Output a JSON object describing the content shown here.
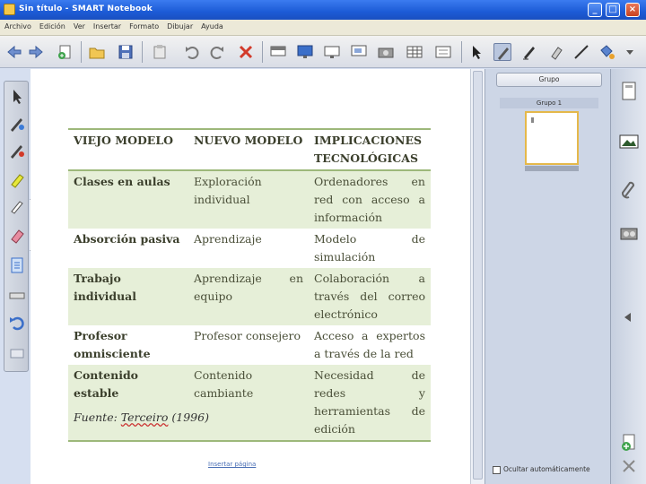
{
  "window": {
    "title": "Sin título - SMART Notebook",
    "buttons": {
      "minimize": "_",
      "maximize": "□",
      "close": "×"
    }
  },
  "menu": [
    "Archivo",
    "Edición",
    "Ver",
    "Insertar",
    "Formato",
    "Dibujar",
    "Ayuda"
  ],
  "table": {
    "headers": [
      "VIEJO MODELO",
      "NUEVO MODELO",
      "IMPLICACIONES TECNOLÓGICAS"
    ],
    "rows": [
      [
        "Clases en aulas",
        "Exploración individual",
        "Ordenadores en red con acceso a información"
      ],
      [
        "Absorción pasiva",
        "Aprendizaje",
        "Modelo de simulación"
      ],
      [
        "Trabajo individual",
        "Aprendizaje en equipo",
        "Colaboración a través del correo electrónico"
      ],
      [
        "Profesor omnisciente",
        "Profesor consejero",
        "Acceso a expertos a través de la red"
      ],
      [
        "Contenido estable",
        "Contenido cambiante",
        "Necesidad de redes y herramientas de edición"
      ]
    ]
  },
  "source": {
    "prefix": "Fuente: ",
    "author": "Terceiro",
    "year": " (1996)"
  },
  "page_link": "Insertar página",
  "sorter": {
    "group_button": "Grupo",
    "group_label": "Grupo 1",
    "auto_hide": "Ocultar automáticamente"
  },
  "colors": {
    "title_bar": "#1c5bd6",
    "table_band": "#e6efd8",
    "table_rule": "#9db87a",
    "panel": "#cdd6e6"
  },
  "icons": {
    "toolbar": [
      "back-arrow-icon",
      "forward-arrow-icon",
      "add-page-icon",
      "open-folder-icon",
      "save-icon",
      "paste-icon",
      "undo-icon",
      "redo-icon",
      "delete-icon",
      "screen-shade-icon",
      "full-screen-icon",
      "dual-page-icon",
      "capture-icon",
      "table-icon",
      "select-icon",
      "pen-icon",
      "creative-pen-icon",
      "eraser-icon",
      "line-icon",
      "fill-icon"
    ],
    "left_toolbar": [
      "select-icon",
      "pen-icon",
      "highlighter-icon",
      "creative-pen-icon",
      "eraser-icon",
      "shapes-icon",
      "page-icon",
      "undo-icon"
    ],
    "right_tabs": [
      "page-sorter-icon",
      "gallery-icon",
      "attachments-icon",
      "properties-icon"
    ]
  }
}
